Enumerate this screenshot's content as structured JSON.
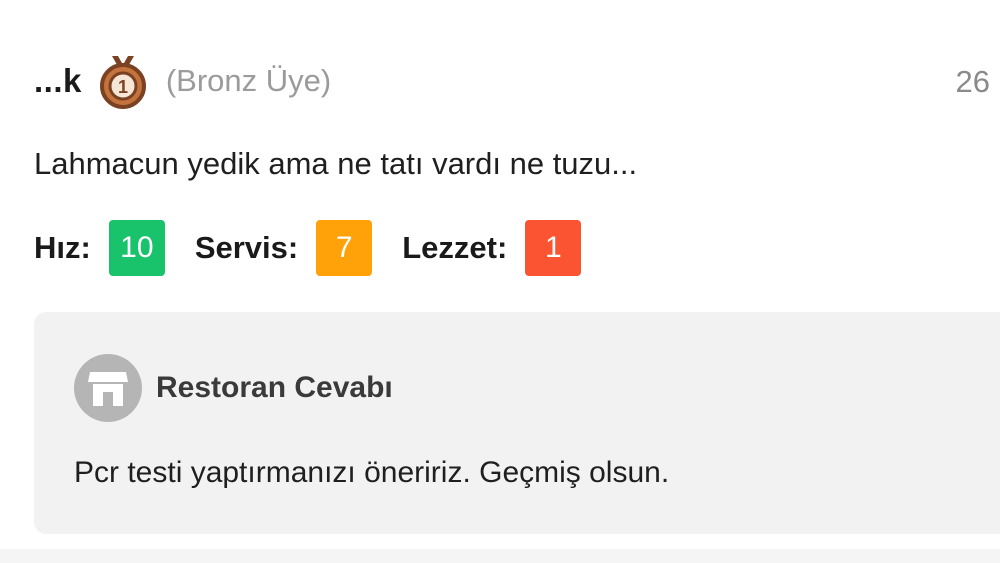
{
  "review": {
    "username": "...k",
    "membership": "(Bronz Üye)",
    "timestamp": "26",
    "medal_icon": "bronze-medal-icon",
    "text": "Lahmacun yedik ama ne tatı vardı ne tuzu...",
    "ratings": [
      {
        "label": "Hız:",
        "value": "10",
        "color": "#19c36b"
      },
      {
        "label": "Servis:",
        "value": "7",
        "color": "#ffa20a"
      },
      {
        "label": "Lezzet:",
        "value": "1",
        "color": "#fb5432"
      }
    ]
  },
  "reply": {
    "icon": "store-icon",
    "title": "Restoran Cevabı",
    "text": "Pcr testi yaptırmanızı öneririz. Geçmiş olsun."
  },
  "colors": {
    "medal": "#c4733c",
    "medal_dark": "#7a4122"
  }
}
